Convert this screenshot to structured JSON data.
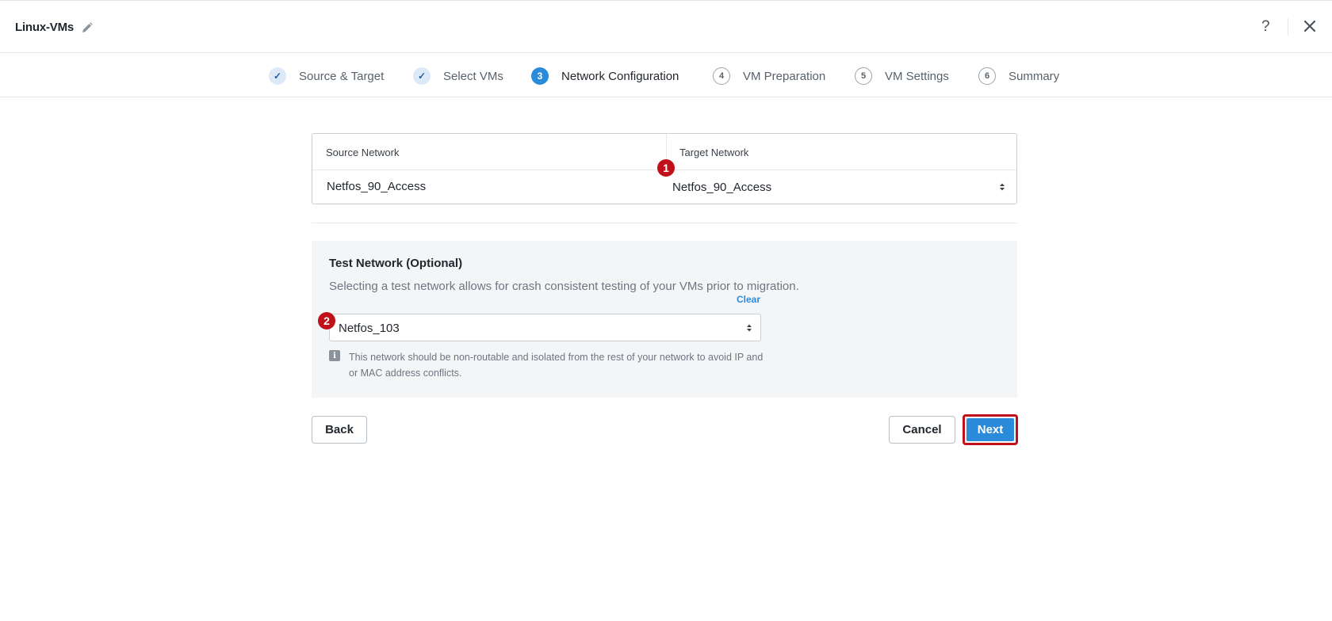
{
  "header": {
    "title": "Linux-VMs",
    "edit_icon": "pencil-icon",
    "help_label": "?",
    "close_icon": "close-icon"
  },
  "stepper": {
    "steps": [
      {
        "badge": "✓",
        "label": "Source & Target",
        "state": "done"
      },
      {
        "badge": "✓",
        "label": "Select VMs",
        "state": "done"
      },
      {
        "badge": "3",
        "label": "Network Configuration",
        "state": "active"
      },
      {
        "badge": "4",
        "label": "VM Preparation",
        "state": "pending"
      },
      {
        "badge": "5",
        "label": "VM Settings",
        "state": "pending"
      },
      {
        "badge": "6",
        "label": "Summary",
        "state": "pending"
      }
    ]
  },
  "mapping": {
    "source_header": "Source Network",
    "target_header": "Target Network",
    "source_value": "Netfos_90_Access",
    "target_value": "Netfos_90_Access"
  },
  "markers": [
    "1",
    "2"
  ],
  "test_network": {
    "title": "Test Network (Optional)",
    "description": "Selecting a test network allows for crash consistent testing of your VMs prior to migration.",
    "clear_label": "Clear",
    "selected_value": "Netfos_103",
    "info_icon": "info-icon",
    "info_text": "This network should be non-routable and isolated from the rest of your network to avoid IP and or MAC address conflicts."
  },
  "buttons": {
    "back": "Back",
    "cancel": "Cancel",
    "next": "Next"
  },
  "colors": {
    "accent": "#2b8bdb",
    "marker": "#c0101a",
    "panel_bg": "#f4f5f7"
  }
}
